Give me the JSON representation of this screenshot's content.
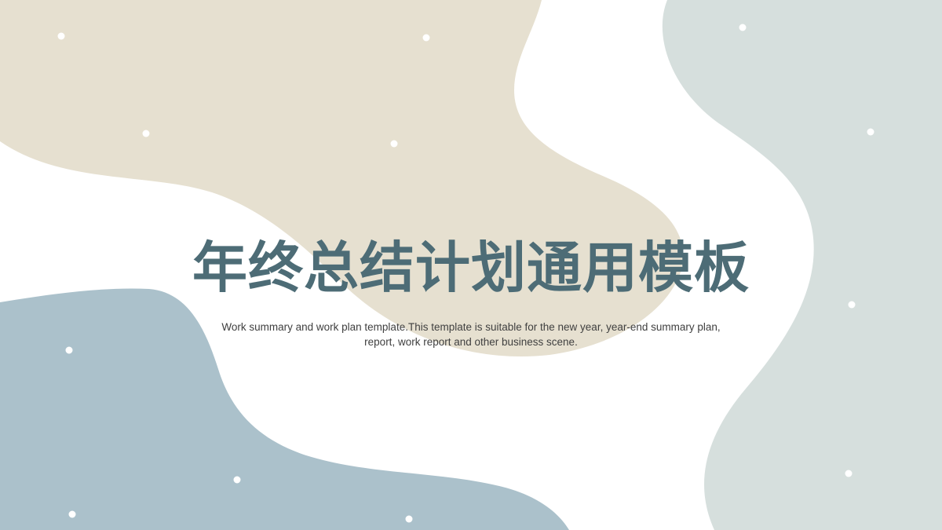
{
  "slide": {
    "title": "年终总结计划通用模板",
    "subtitle_line1": "Work summary and work plan template.This template is suitable for the new year, year-end summary plan,",
    "subtitle_line2": "report, work report and other business scene."
  },
  "colors": {
    "background": "#ffffff",
    "beige_shape": "#e6e0d0",
    "blue_shape": "#abc1cb",
    "gray_shape": "#d6dfdd",
    "title_text": "#4d6c76",
    "subtitle_text": "#3f3f3f",
    "dots": "#ffffff"
  }
}
